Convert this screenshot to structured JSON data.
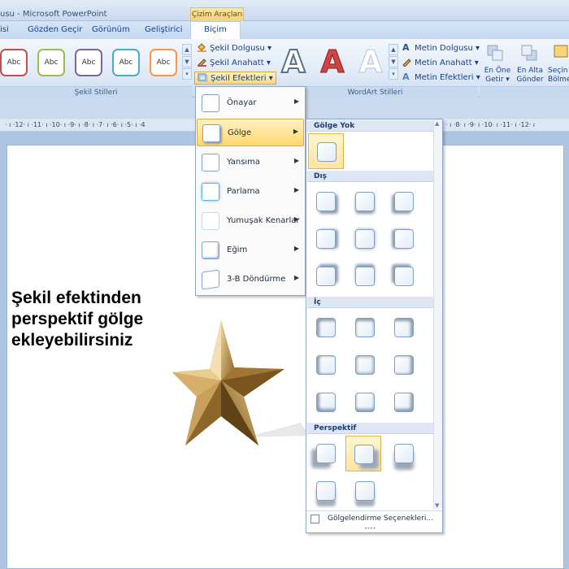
{
  "titlebar": {
    "title": "usu - Microsoft PowerPoint",
    "context_group": "Çizim Araçları"
  },
  "tabs": {
    "items": [
      "isi",
      "Gözden Geçir",
      "Görünüm",
      "Geliştirici"
    ],
    "active": "Biçim"
  },
  "ribbon": {
    "shape_styles": {
      "label": "Şekil Stilleri",
      "swatch_text": "Abc",
      "swatch_colors": [
        "#c0504d",
        "#9bbb59",
        "#8064a2",
        "#4bacc6",
        "#f79646"
      ]
    },
    "shape_commands": {
      "fill": "Şekil Dolgusu",
      "outline": "Şekil Anahatt",
      "effects": "Şekil Efektleri"
    },
    "wordart": {
      "label": "WordArt Stilleri",
      "letter": "A",
      "fill": "Metin Dolgusu",
      "outline": "Metin Anahatt",
      "effects": "Metin Efektleri"
    },
    "arrange": {
      "bring_front_1": "En Öne",
      "bring_front_2": "Getir",
      "send_back_1": "En Alta",
      "send_back_2": "Gönder",
      "selection_1": "Seçin",
      "selection_2": "Bölme"
    }
  },
  "ruler_text": "· ı ·12· ı ·11· ı ·10· ı ·9· ı ·8· ı ·7· ı ·6· ı ·5· ı ·4",
  "ruler_right_text": "· ı ·8· ı ·9· ı ·10· ı ·11· ı ·12· ı",
  "document": {
    "line1": "Şekil efektinden",
    "line2": "perspektif gölge",
    "line3": "ekleyebilirsiniz"
  },
  "effects_menu": {
    "items": [
      {
        "label": "Önayar"
      },
      {
        "label": "Gölge"
      },
      {
        "label": "Yansıma"
      },
      {
        "label": "Parlama"
      },
      {
        "label": "Yumuşak Kenarlar"
      },
      {
        "label": "Eğim"
      },
      {
        "label": "3-B Döndürme"
      }
    ],
    "active_index": 1
  },
  "shadow_gallery": {
    "no_shadow": "Gölge Yok",
    "outer": "Dış",
    "inner": "İç",
    "perspective": "Perspektif",
    "options": "Gölgelendirme Seçenekleri..."
  },
  "colors": {
    "accent_hover": "#ffd76d",
    "ribbon_blue": "#dfe9f6",
    "text_blue": "#15428b"
  }
}
